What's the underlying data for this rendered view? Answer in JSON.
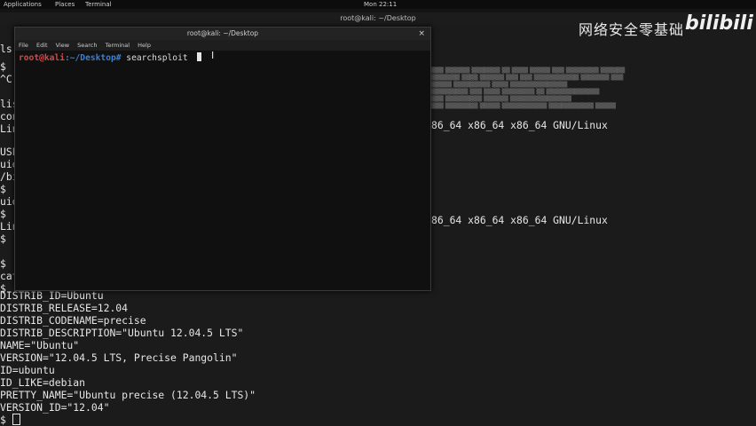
{
  "topbar": {
    "applications": "Applications",
    "places": "Places",
    "terminal": "Terminal",
    "clock": "Mon 22:11"
  },
  "bg_window": {
    "title": "root@kali: ~/Desktop"
  },
  "watermark": {
    "text": "网络安全零基础",
    "brand": "bilibili"
  },
  "bg_terminal": {
    "lines_left": [
      "ls",
      "$",
      "^C",
      "",
      "lis",
      "con",
      "Lin",
      "",
      "USE",
      "uid",
      "/bi",
      "$",
      "uid",
      "$",
      "Lin",
      "$",
      "",
      "$",
      "cat",
      "$",
      "DISTRIB_ID=Ubuntu",
      "DISTRIB_RELEASE=12.04",
      "DISTRIB_CODENAME=precise",
      "DISTRIB_DESCRIPTION=\"Ubuntu 12.04.5 LTS\"",
      "NAME=\"Ubuntu\"",
      "VERSION=\"12.04.5 LTS, Precise Pangolin\"",
      "ID=ubuntu",
      "ID_LIKE=debian",
      "PRETTY_NAME=\"Ubuntu precise (12.04.5 LTS)\"",
      "VERSION_ID=\"12.04\"",
      "$"
    ],
    "right_line_1": "86_64 x86_64 x86_64 GNU/Linux",
    "right_line_2": "86_64 x86_64 x86_64 GNU/Linux"
  },
  "fg_window": {
    "title": "root@kali: ~/Desktop",
    "close": "×",
    "menu": [
      "File",
      "Edit",
      "View",
      "Search",
      "Terminal",
      "Help"
    ],
    "prompt_user": "root@kali",
    "prompt_path": ":~/Desktop#",
    "command": " searchsploit"
  }
}
